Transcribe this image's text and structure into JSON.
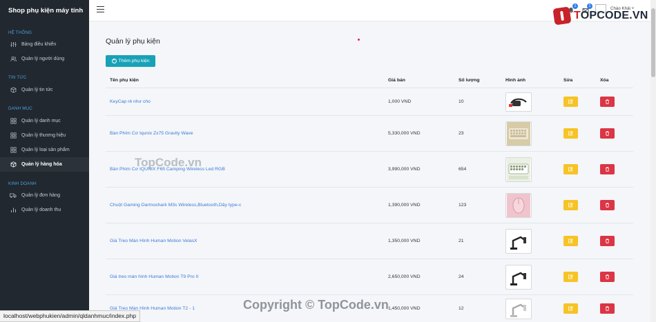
{
  "app": {
    "brand": "Shop phụ kiện máy tính"
  },
  "sidebar": {
    "sections": [
      {
        "title": "HỆ THỐNG",
        "items": [
          {
            "label": "Bảng điều khiển",
            "icon": "sliders-icon",
            "active": false
          },
          {
            "label": "Quản lý người dùng",
            "icon": "users-icon",
            "active": false
          }
        ]
      },
      {
        "title": "TIN TỨC",
        "items": [
          {
            "label": "Quản lý tin tức",
            "icon": "box-icon",
            "active": false
          }
        ]
      },
      {
        "title": "DANH MỤC",
        "items": [
          {
            "label": "Quản lý danh mục",
            "icon": "grid-icon",
            "active": false
          },
          {
            "label": "Quản lý thương hiệu",
            "icon": "grid-icon",
            "active": false
          },
          {
            "label": "Quản lý loại sản phẩm",
            "icon": "grid-icon",
            "active": false
          },
          {
            "label": "Quản lý hàng hóa",
            "icon": "box-icon",
            "active": true
          }
        ]
      },
      {
        "title": "KINH DOANH",
        "items": [
          {
            "label": "Quản lý đơn hàng",
            "icon": "truck-icon",
            "active": false
          },
          {
            "label": "Quản lý doanh thu",
            "icon": "bar-chart-icon",
            "active": false
          }
        ]
      }
    ]
  },
  "header": {
    "notifications": [
      {
        "icon": "bell-icon",
        "count": "1"
      },
      {
        "icon": "mail-icon",
        "count": "1"
      }
    ],
    "user_name": "Chào Khải"
  },
  "logo": {
    "text_prefix": "T",
    "text_rest": "OPCODE.VN"
  },
  "main": {
    "title": "Quản lý phụ kiện",
    "add_button": "Thêm phụ kiện",
    "columns": {
      "name": "Tên phụ kiện",
      "price": "Giá bán",
      "qty": "Số lượng",
      "image": "Hình ảnh",
      "edit": "Sửa",
      "delete": "Xóa"
    },
    "rows": [
      {
        "name": "KeyCap rẻ như cho",
        "price": "1,000 VND",
        "qty": "10",
        "image": "keycap-cable-image"
      },
      {
        "name": "Bàn Phím Cơ Iqunix Zx75 Gravity Wave",
        "price": "5,330,000 VND",
        "qty": "23",
        "image": "keyboard-beige-image"
      },
      {
        "name": "Bàn Phím Cơ IQUNIX F65 Camping Wireless Led RGB",
        "price": "3,990,000 VND",
        "qty": "654",
        "image": "keyboard-camping-image"
      },
      {
        "name": "Chuột Gaming Darmoshark M3s Wireless,Bluetooth,Dây type-c",
        "price": "1,390,000 VND",
        "qty": "123",
        "image": "pink-mouse-image"
      },
      {
        "name": "Giá Treo Màn Hình Human Motion VelasX",
        "price": "1,350,000 VND",
        "qty": "21",
        "image": "monitor-arm-image"
      },
      {
        "name": "Giá treo màn hình Human Motion T9 Pro II",
        "price": "2,650,000 VND",
        "qty": "24",
        "image": "monitor-arm-image"
      },
      {
        "name": "Giá Treo Màn Hình Human Motion T2 - 1",
        "price": "1,450,000 VND",
        "qty": "12",
        "image": "monitor-arm-white-image"
      }
    ]
  },
  "statusbar": {
    "url": "localhost/webphukien/admin/qldanhmuc/index.php"
  },
  "watermarks": {
    "center": "TopCode.vn",
    "bottom": "Copyright © TopCode.vn"
  },
  "colors": {
    "sidebar_bg": "#22282f",
    "accent": "#17a2b8",
    "edit": "#f7c325",
    "delete": "#dc3545",
    "link": "#3a7bd5",
    "section_title": "#4aa3df"
  }
}
